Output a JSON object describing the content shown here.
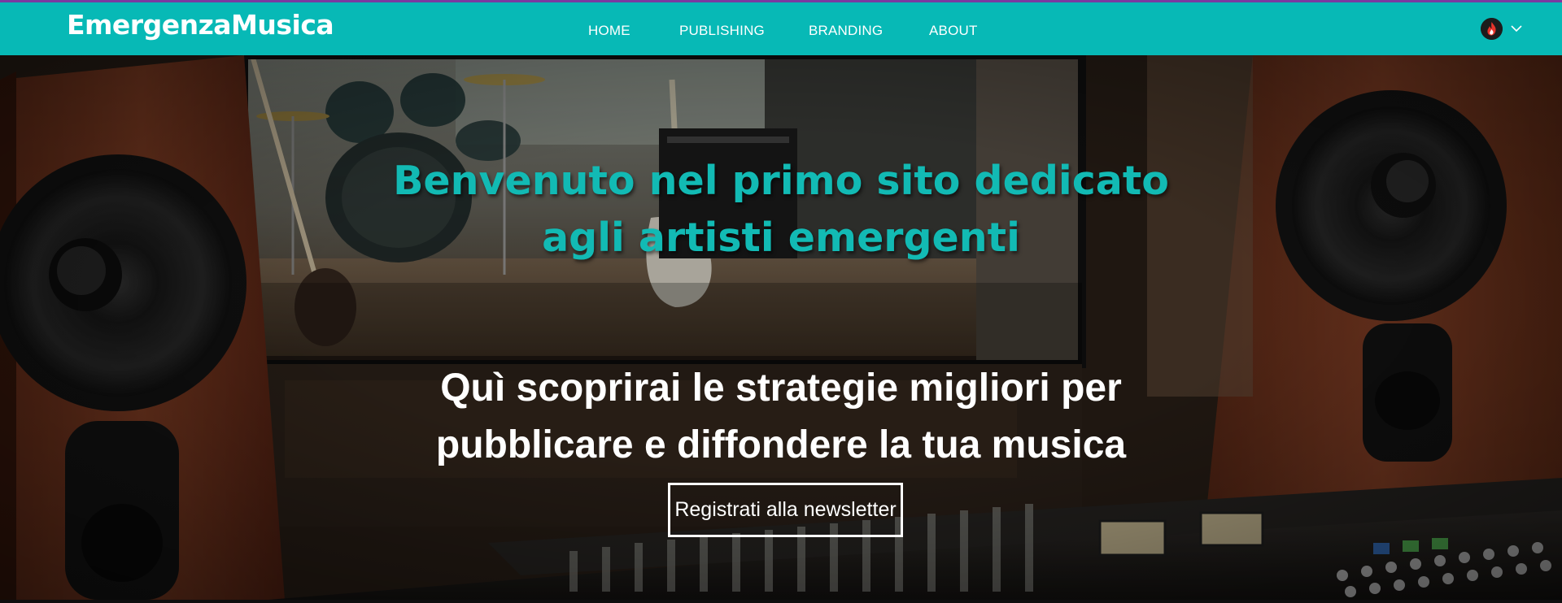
{
  "header": {
    "logo_text": "EmergenzaMusica",
    "nav": [
      {
        "label": "HOME"
      },
      {
        "label": "PUBLISHING"
      },
      {
        "label": "BRANDING"
      },
      {
        "label": "ABOUT"
      }
    ],
    "account": {
      "avatar_icon": "flame-avatar-icon",
      "menu_icon": "chevron-down-icon"
    }
  },
  "hero": {
    "title": "Benvenuto nel primo sito dedicato agli artisti emergenti",
    "subtitle": "Quì scoprirai le strategie migliori per pubblicare e diffondere la tua musica",
    "cta_label": "Registrati alla newsletter",
    "background_description_icon": "recording-studio-image"
  },
  "colors": {
    "header_bg": "#07b9b6",
    "header_top_border": "#7a3aa0",
    "title_color": "#12bab4",
    "text_light": "#ffffff"
  }
}
